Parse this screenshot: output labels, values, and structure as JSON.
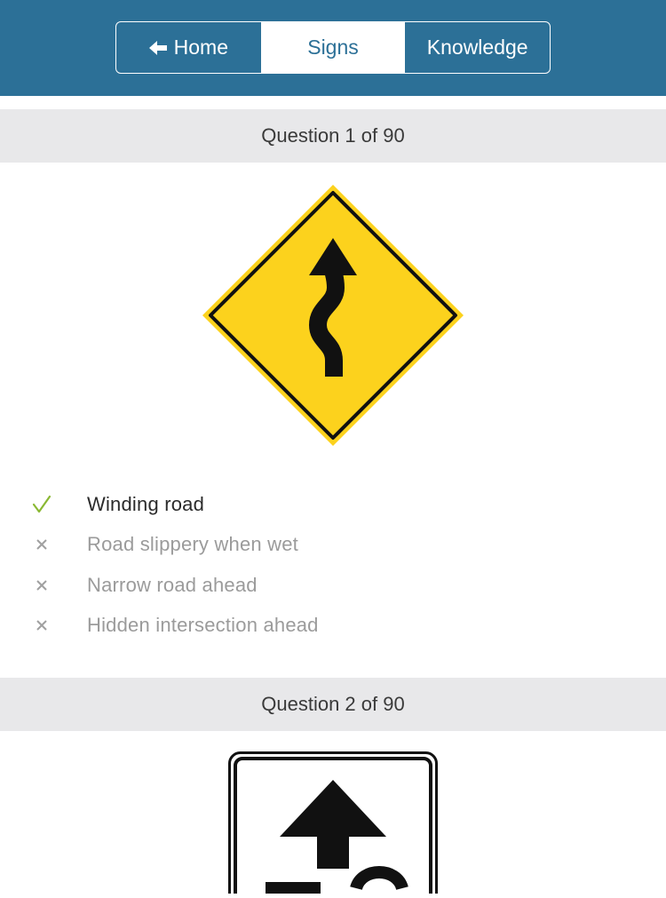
{
  "nav": {
    "tabs": [
      {
        "label": "Home",
        "icon": "arrow-left-icon",
        "active": false
      },
      {
        "label": "Signs",
        "active": true
      },
      {
        "label": "Knowledge",
        "active": false
      }
    ],
    "colors": {
      "bar": "#2c7097",
      "active_text": "#2c7097"
    }
  },
  "questions": [
    {
      "header": "Question 1 of 90",
      "sign": "winding-road-warning-sign",
      "answers": [
        {
          "label": "Winding road",
          "status": "correct",
          "icon": "checkmark-icon"
        },
        {
          "label": "Road slippery when wet",
          "status": "wrong",
          "icon": "x-icon"
        },
        {
          "label": "Narrow road ahead",
          "status": "wrong",
          "icon": "x-icon"
        },
        {
          "label": "Hidden intersection ahead",
          "status": "wrong",
          "icon": "x-icon"
        }
      ]
    },
    {
      "header": "Question 2 of 90",
      "sign": "speed-limit-ahead-sign"
    }
  ],
  "colors": {
    "correct_mark": "#8ab833",
    "wrong_mark": "#a0a0a0",
    "sign_yellow": "#fcd21d",
    "question_bar": "#e8e8ea"
  }
}
